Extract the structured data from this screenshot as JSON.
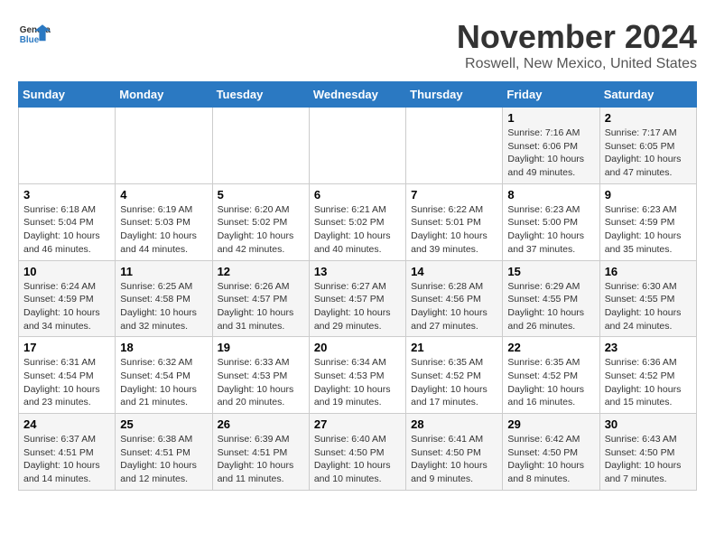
{
  "header": {
    "logo_general": "General",
    "logo_blue": "Blue",
    "month": "November 2024",
    "location": "Roswell, New Mexico, United States"
  },
  "weekdays": [
    "Sunday",
    "Monday",
    "Tuesday",
    "Wednesday",
    "Thursday",
    "Friday",
    "Saturday"
  ],
  "weeks": [
    [
      {
        "day": "",
        "info": ""
      },
      {
        "day": "",
        "info": ""
      },
      {
        "day": "",
        "info": ""
      },
      {
        "day": "",
        "info": ""
      },
      {
        "day": "",
        "info": ""
      },
      {
        "day": "1",
        "info": "Sunrise: 7:16 AM\nSunset: 6:06 PM\nDaylight: 10 hours\nand 49 minutes."
      },
      {
        "day": "2",
        "info": "Sunrise: 7:17 AM\nSunset: 6:05 PM\nDaylight: 10 hours\nand 47 minutes."
      }
    ],
    [
      {
        "day": "3",
        "info": "Sunrise: 6:18 AM\nSunset: 5:04 PM\nDaylight: 10 hours\nand 46 minutes."
      },
      {
        "day": "4",
        "info": "Sunrise: 6:19 AM\nSunset: 5:03 PM\nDaylight: 10 hours\nand 44 minutes."
      },
      {
        "day": "5",
        "info": "Sunrise: 6:20 AM\nSunset: 5:02 PM\nDaylight: 10 hours\nand 42 minutes."
      },
      {
        "day": "6",
        "info": "Sunrise: 6:21 AM\nSunset: 5:02 PM\nDaylight: 10 hours\nand 40 minutes."
      },
      {
        "day": "7",
        "info": "Sunrise: 6:22 AM\nSunset: 5:01 PM\nDaylight: 10 hours\nand 39 minutes."
      },
      {
        "day": "8",
        "info": "Sunrise: 6:23 AM\nSunset: 5:00 PM\nDaylight: 10 hours\nand 37 minutes."
      },
      {
        "day": "9",
        "info": "Sunrise: 6:23 AM\nSunset: 4:59 PM\nDaylight: 10 hours\nand 35 minutes."
      }
    ],
    [
      {
        "day": "10",
        "info": "Sunrise: 6:24 AM\nSunset: 4:59 PM\nDaylight: 10 hours\nand 34 minutes."
      },
      {
        "day": "11",
        "info": "Sunrise: 6:25 AM\nSunset: 4:58 PM\nDaylight: 10 hours\nand 32 minutes."
      },
      {
        "day": "12",
        "info": "Sunrise: 6:26 AM\nSunset: 4:57 PM\nDaylight: 10 hours\nand 31 minutes."
      },
      {
        "day": "13",
        "info": "Sunrise: 6:27 AM\nSunset: 4:57 PM\nDaylight: 10 hours\nand 29 minutes."
      },
      {
        "day": "14",
        "info": "Sunrise: 6:28 AM\nSunset: 4:56 PM\nDaylight: 10 hours\nand 27 minutes."
      },
      {
        "day": "15",
        "info": "Sunrise: 6:29 AM\nSunset: 4:55 PM\nDaylight: 10 hours\nand 26 minutes."
      },
      {
        "day": "16",
        "info": "Sunrise: 6:30 AM\nSunset: 4:55 PM\nDaylight: 10 hours\nand 24 minutes."
      }
    ],
    [
      {
        "day": "17",
        "info": "Sunrise: 6:31 AM\nSunset: 4:54 PM\nDaylight: 10 hours\nand 23 minutes."
      },
      {
        "day": "18",
        "info": "Sunrise: 6:32 AM\nSunset: 4:54 PM\nDaylight: 10 hours\nand 21 minutes."
      },
      {
        "day": "19",
        "info": "Sunrise: 6:33 AM\nSunset: 4:53 PM\nDaylight: 10 hours\nand 20 minutes."
      },
      {
        "day": "20",
        "info": "Sunrise: 6:34 AM\nSunset: 4:53 PM\nDaylight: 10 hours\nand 19 minutes."
      },
      {
        "day": "21",
        "info": "Sunrise: 6:35 AM\nSunset: 4:52 PM\nDaylight: 10 hours\nand 17 minutes."
      },
      {
        "day": "22",
        "info": "Sunrise: 6:35 AM\nSunset: 4:52 PM\nDaylight: 10 hours\nand 16 minutes."
      },
      {
        "day": "23",
        "info": "Sunrise: 6:36 AM\nSunset: 4:52 PM\nDaylight: 10 hours\nand 15 minutes."
      }
    ],
    [
      {
        "day": "24",
        "info": "Sunrise: 6:37 AM\nSunset: 4:51 PM\nDaylight: 10 hours\nand 14 minutes."
      },
      {
        "day": "25",
        "info": "Sunrise: 6:38 AM\nSunset: 4:51 PM\nDaylight: 10 hours\nand 12 minutes."
      },
      {
        "day": "26",
        "info": "Sunrise: 6:39 AM\nSunset: 4:51 PM\nDaylight: 10 hours\nand 11 minutes."
      },
      {
        "day": "27",
        "info": "Sunrise: 6:40 AM\nSunset: 4:50 PM\nDaylight: 10 hours\nand 10 minutes."
      },
      {
        "day": "28",
        "info": "Sunrise: 6:41 AM\nSunset: 4:50 PM\nDaylight: 10 hours\nand 9 minutes."
      },
      {
        "day": "29",
        "info": "Sunrise: 6:42 AM\nSunset: 4:50 PM\nDaylight: 10 hours\nand 8 minutes."
      },
      {
        "day": "30",
        "info": "Sunrise: 6:43 AM\nSunset: 4:50 PM\nDaylight: 10 hours\nand 7 minutes."
      }
    ]
  ]
}
